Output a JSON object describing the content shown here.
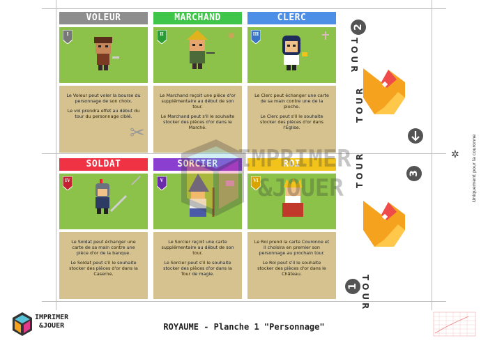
{
  "footer": {
    "title": "ROYAUME - Planche 1 \"Personnage\""
  },
  "side_note": "Uniquement pour la couronne",
  "logo": {
    "line1": "IMPRIMER",
    "line2": "&JOUER"
  },
  "watermark": {
    "line1": "IMPRIMER",
    "line2": "&JOUER"
  },
  "cards": [
    {
      "name": "VOLEUR",
      "numeral": "I",
      "header_color": "#8d8d8d",
      "art_color": "#8cc14a",
      "p1": "Le Voleur peut voler la bourse du personnage de son choix.",
      "p2": "Le vol prendra effet au début du tour du personnage ciblé."
    },
    {
      "name": "MARCHAND",
      "numeral": "II",
      "header_color": "#3fc64a",
      "art_color": "#8cc14a",
      "p1": "Le Marchand reçoit une pièce d'or supplémentaire au début de son tour.",
      "p2": "Le Marchand peut s'il le souhaite stocker des pièces d'or dans le Marché."
    },
    {
      "name": "CLERC",
      "numeral": "III",
      "header_color": "#4d8ee6",
      "art_color": "#8cc14a",
      "p1": "Le Clerc peut échanger une carte de sa main contre une de la pioche.",
      "p2": "Le Clerc peut s'il le souhaite stocker des pièces d'or dans l'Eglise."
    },
    {
      "name": "SOLDAT",
      "numeral": "IV",
      "header_color": "#ef3344",
      "art_color": "#8cc14a",
      "p1": "Le Soldat peut échanger une carte de sa main contre une pièce d'or de la banque.",
      "p2": "Le Soldat peut s'il le souhaite stocker des pièces d'or dans la Caserne."
    },
    {
      "name": "SORCIER",
      "numeral": "V",
      "header_color": "#8b3fd1",
      "art_color": "#8cc14a",
      "p1": "Le Sorcier reçoit une carte supplémentaire au début de son tour.",
      "p2": "Le Sorcier peut s'il le souhaite stocker des pièces d'or dans la Tour de magie."
    },
    {
      "name": "ROI",
      "numeral": "VI",
      "header_color": "#f2c31b",
      "art_color": "#8cc14a",
      "p1": "Le Roi prend la carte Couronne et il choisira en premier son personnage au prochain tour.",
      "p2": "Le Roi peut s'il le souhaite stocker des pièces d'or dans le Château."
    }
  ],
  "tour_panels": [
    {
      "number": "2",
      "label": "TOUR",
      "bottom_label": "TOUR",
      "arrow": "arrow-down"
    },
    {
      "number": "3",
      "label": "TOUR",
      "bottom_label": "TOUR",
      "bottom_number": "1"
    }
  ],
  "colors": {
    "art_green": "#8cc14a",
    "desc_tan": "#d6c28e",
    "crown_orange": "#f5a21e",
    "crown_light": "#ffc84a"
  }
}
